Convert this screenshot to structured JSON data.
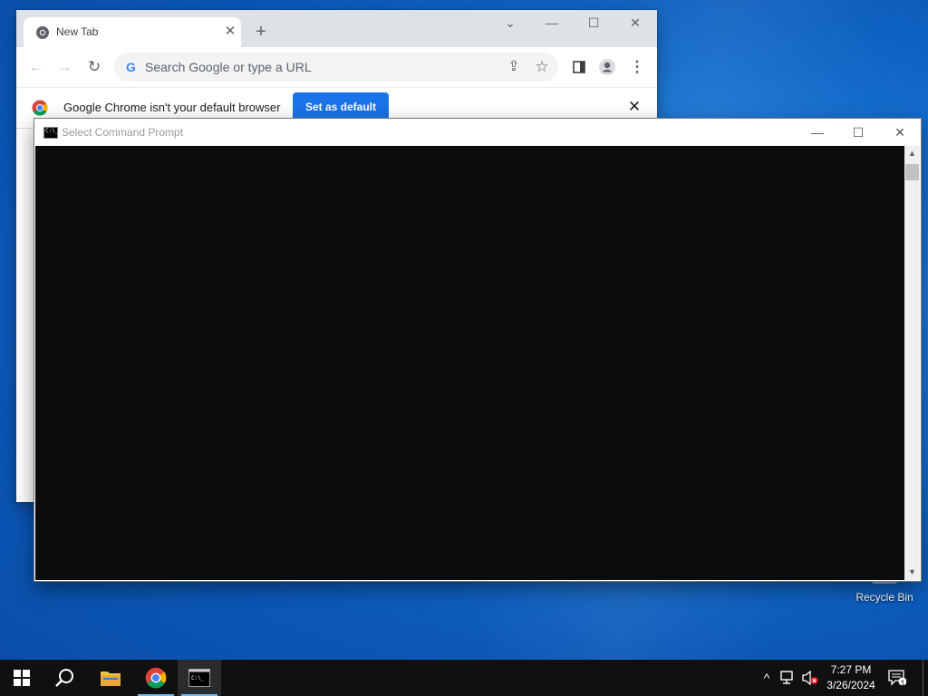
{
  "chrome": {
    "tab_title": "New Tab",
    "omnibox_placeholder": "Search Google or type a URL",
    "infobar_text": "Google Chrome isn't your default browser",
    "set_default_label": "Set as default"
  },
  "cmd": {
    "title": "Select Command Prompt"
  },
  "desktop": {
    "recycle_bin_label": "Recycle Bin"
  },
  "taskbar": {
    "time": "7:27 PM",
    "date": "3/26/2024",
    "notification_count": "1",
    "apps": [
      "start-icon",
      "search-icon",
      "file-explorer-icon",
      "chrome-icon",
      "command-prompt-icon"
    ]
  },
  "colors": {
    "accent": "#1a73e8",
    "taskbar": "#101010",
    "console_bg": "#0c0c0c"
  }
}
